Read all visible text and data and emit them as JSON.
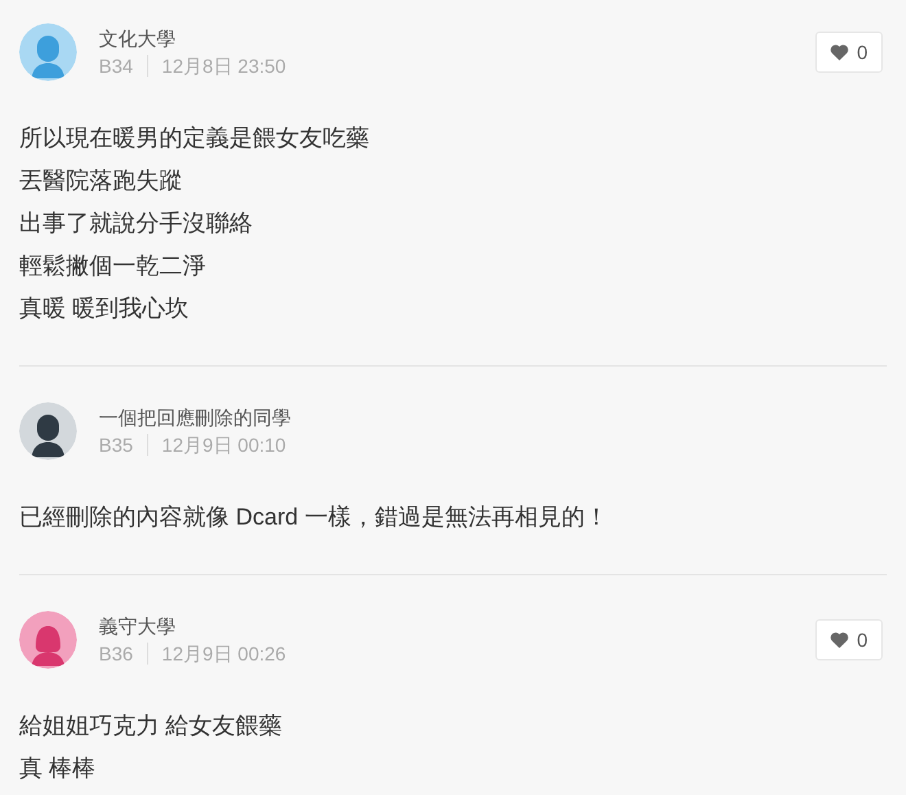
{
  "comments": [
    {
      "author": "文化大學",
      "floor": "B34",
      "time": "12月8日 23:50",
      "avatar": {
        "kind": "male",
        "color": "#3d9fdc"
      },
      "likes": "0",
      "lines": [
        "所以現在暖男的定義是餵女友吃藥",
        "丟醫院落跑失蹤",
        "出事了就說分手沒聯絡",
        "輕鬆撇個一乾二淨",
        "真暖 暖到我心坎"
      ]
    },
    {
      "author": "一個把回應刪除的同學",
      "floor": "B35",
      "time": "12月9日 00:10",
      "avatar": {
        "kind": "male",
        "color": "#2f3a44"
      },
      "lines": [
        "已經刪除的內容就像 Dcard 一樣，錯過是無法再相見的！"
      ]
    },
    {
      "author": "義守大學",
      "floor": "B36",
      "time": "12月9日 00:26",
      "avatar": {
        "kind": "female",
        "color": "#d9376e"
      },
      "likes": "0",
      "lines": [
        "給姐姐巧克力 給女友餵藥",
        "真 棒棒"
      ]
    }
  ]
}
